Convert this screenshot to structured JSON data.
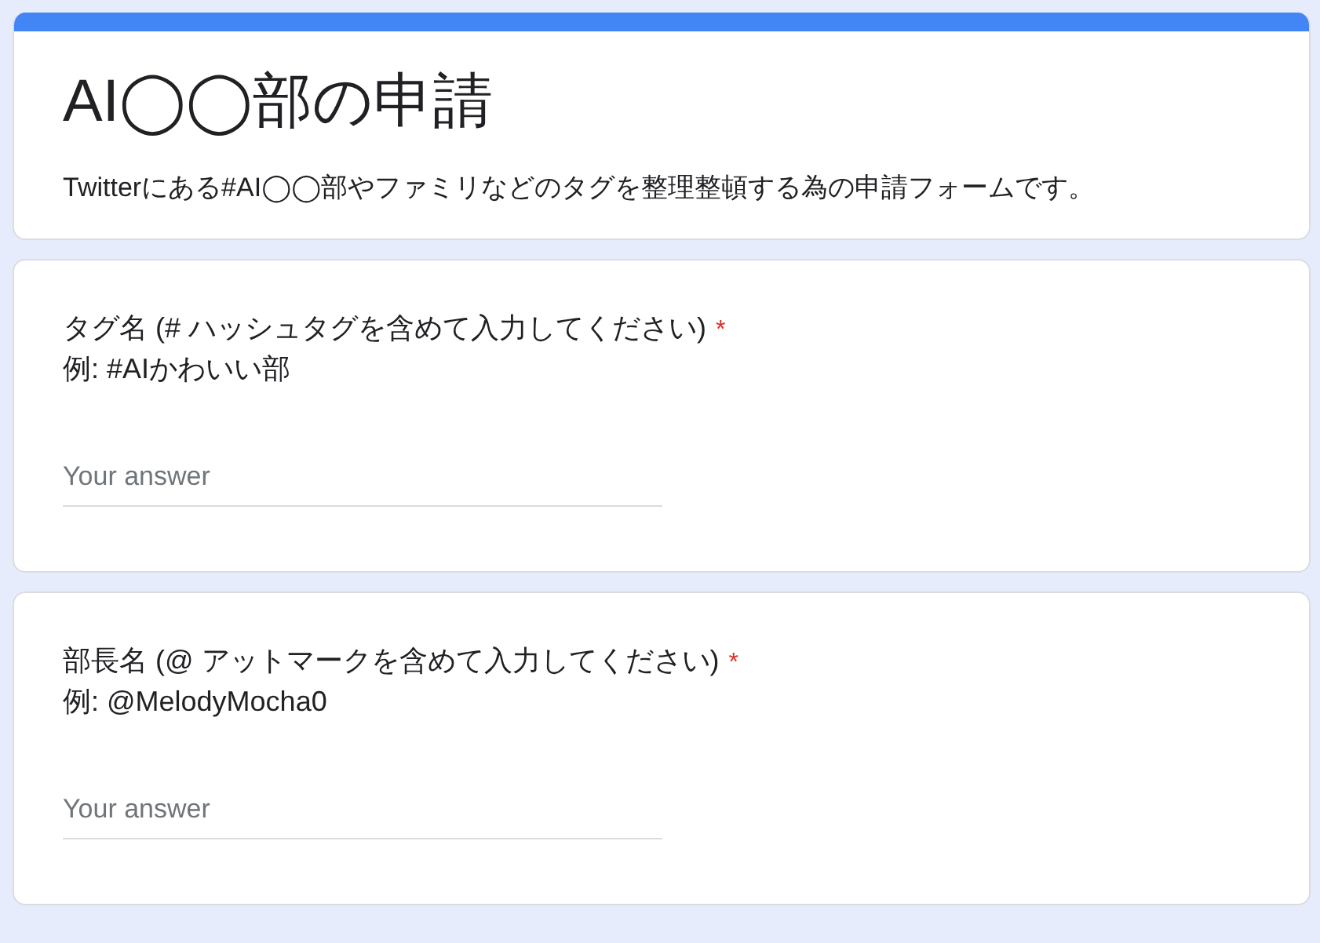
{
  "form": {
    "title": "AI◯◯部の申請",
    "description": "Twitterにある#AI◯◯部やファミリなどのタグを整理整頓する為の申請フォームです。"
  },
  "questions": [
    {
      "title": "タグ名 (# ハッシュタグを含めて入力してください)",
      "required_mark": "*",
      "hint": "例: #AIかわいい部",
      "placeholder": "Your answer"
    },
    {
      "title": "部長名 (@ アットマークを含めて入力してください)",
      "required_mark": "*",
      "hint": "例: @MelodyMocha0",
      "placeholder": "Your answer"
    }
  ]
}
